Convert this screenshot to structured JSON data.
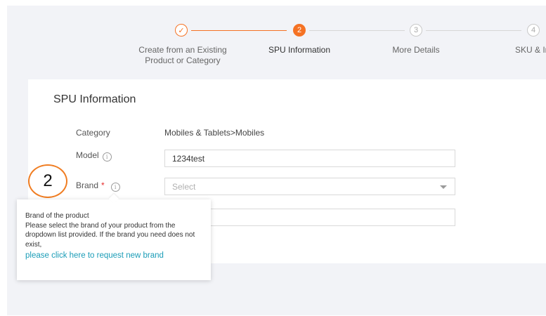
{
  "steps": [
    {
      "number": "✓",
      "label_line1": "Create from an Existing",
      "label_line2": "Product or Category",
      "state": "done"
    },
    {
      "number": "2",
      "label_line1": "SPU Information",
      "label_line2": "",
      "state": "active"
    },
    {
      "number": "3",
      "label_line1": "More Details",
      "label_line2": "",
      "state": "todo"
    },
    {
      "number": "4",
      "label_line1": "SKU & Ima",
      "label_line2": "",
      "state": "todo"
    }
  ],
  "section": {
    "title": "SPU Information"
  },
  "fields": {
    "category": {
      "label": "Category",
      "value": "Mobiles & Tablets>Mobiles"
    },
    "model": {
      "label": "Model",
      "value": "1234test"
    },
    "brand": {
      "label": "Brand",
      "required_mark": "*",
      "placeholder": "Select"
    }
  },
  "annotation": {
    "number": "2"
  },
  "tooltip": {
    "title": "Brand of the product",
    "body": "Please select the brand of your product from the dropdown list provided. If the brand you need does not exist,",
    "link": "please click here to request new brand"
  },
  "colors": {
    "accent": "#f57224",
    "link": "#1a9cb7",
    "required": "#e62c2c"
  },
  "icons": {
    "info": "info-icon",
    "check": "check-icon",
    "caret": "chevron-down-icon"
  }
}
